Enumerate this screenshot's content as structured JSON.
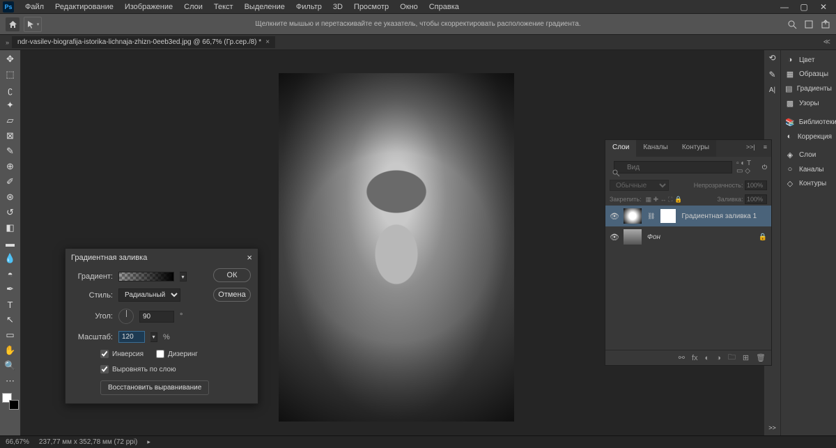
{
  "app": {
    "ps_badge": "Ps"
  },
  "menu": {
    "items": [
      "Файл",
      "Редактирование",
      "Изображение",
      "Слои",
      "Текст",
      "Выделение",
      "Фильтр",
      "3D",
      "Просмотр",
      "Окно",
      "Справка"
    ]
  },
  "window_controls": {
    "minimize": "—",
    "maximize": "▢",
    "close": "✕"
  },
  "optionsbar": {
    "hint": "Щелкните мышью и перетаскивайте ее указатель, чтобы скорректировать расположение градиента."
  },
  "doctab": {
    "title": "ndr-vasilev-biografija-istorika-lichnaja-zhizn-0eeb3ed.jpg @ 66,7% (Гр.сер./8) *",
    "expand": ">>"
  },
  "tools": {
    "names": [
      "move",
      "marquee",
      "lasso",
      "wand",
      "crop",
      "frame",
      "eyedropper",
      "spot-heal",
      "brush",
      "clone",
      "history-brush",
      "eraser",
      "gradient",
      "blur",
      "dodge",
      "pen",
      "type",
      "path-select",
      "rectangle",
      "hand",
      "zoom",
      "edit-toolbar"
    ]
  },
  "right_icons": {
    "top": [
      "history",
      "brush-presets",
      "char"
    ],
    "chevron": ">>"
  },
  "far_panels": {
    "items": [
      {
        "icon": "◑",
        "label": "Цвет"
      },
      {
        "icon": "▦",
        "label": "Образцы"
      },
      {
        "icon": "▤",
        "label": "Градиенты"
      },
      {
        "icon": "▩",
        "label": "Узоры"
      },
      {
        "icon": "",
        "label": ""
      },
      {
        "icon": "📚",
        "label": "Библиотеки"
      },
      {
        "icon": "◐",
        "label": "Коррекция"
      },
      {
        "icon": "",
        "label": ""
      },
      {
        "icon": "◈",
        "label": "Слои"
      },
      {
        "icon": "○",
        "label": "Каналы"
      },
      {
        "icon": "◇",
        "label": "Контуры"
      }
    ]
  },
  "layers_panel": {
    "tabs": [
      "Слои",
      "Каналы",
      "Контуры"
    ],
    "search_placeholder": "Вид",
    "blend_mode": "Обычные",
    "opacity_label": "Непрозрачность:",
    "opacity_value": "100%",
    "lock_label": "Закрепить:",
    "fill_label": "Заливка:",
    "fill_value": "100%",
    "layers": [
      {
        "name": "Градиентная заливка 1",
        "locked": false,
        "active": true
      },
      {
        "name": "Фон",
        "locked": true,
        "active": false
      }
    ]
  },
  "dialog": {
    "title": "Градиентная заливка",
    "gradient_label": "Градиент:",
    "style_label": "Стиль:",
    "style_value": "Радиальный",
    "angle_label": "Угол:",
    "angle_value": "90",
    "angle_unit": "°",
    "scale_label": "Масштаб:",
    "scale_value": "120",
    "scale_unit": "%",
    "invert_label": "Инверсия",
    "dither_label": "Дизеринг",
    "align_label": "Выровнять по слою",
    "reset_align": "Восстановить выравнивание",
    "ok": "ОК",
    "cancel": "Отмена"
  },
  "status": {
    "zoom": "66,67%",
    "docinfo": "237,77 мм x 352,78 мм (72 ppi)"
  }
}
